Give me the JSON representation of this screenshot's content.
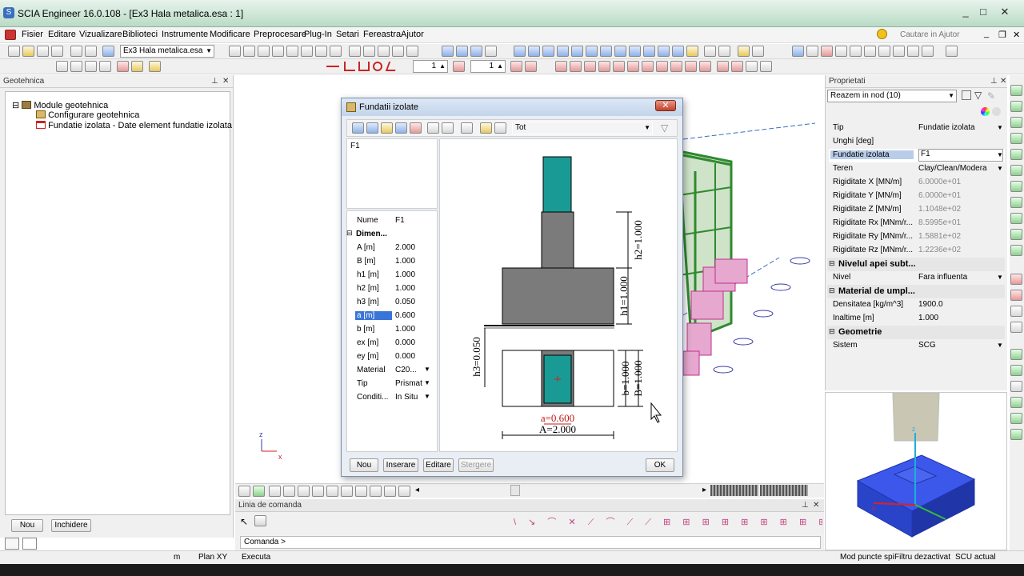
{
  "window": {
    "title": "SCIA Engineer 16.0.108 - [Ex3 Hala metalica.esa : 1]",
    "controls": {
      "minimize": "_",
      "maximize": "□",
      "close": "✕"
    },
    "inner_controls": {
      "minimize": "_",
      "restore": "❐",
      "close": "✕"
    }
  },
  "menu": {
    "items": [
      "Fisier",
      "Editare",
      "Vizualizare",
      "Biblioteci",
      "Instrumente",
      "Modificare",
      "Preprocesare",
      "Plug-In",
      "Setari",
      "Fereastra",
      "Ajutor"
    ],
    "search_placeholder": "Cautare in Ajutor"
  },
  "toolbar": {
    "project_combo": "Ex3 Hala metalica.esa",
    "spin1": "1",
    "spin2": "1"
  },
  "left_panel": {
    "header": "Geotehnica",
    "tree": [
      {
        "label": "Module geotehnica",
        "level": 0,
        "expander": "⊟"
      },
      {
        "label": "Configurare geotehnica",
        "level": 1
      },
      {
        "label": "Fundatie izolata - Date element fundatie izolata",
        "level": 1
      }
    ],
    "buttons": {
      "new": "Nou",
      "close": "Inchidere"
    }
  },
  "dialog": {
    "title": "Fundatii izolate",
    "filter": "Tot",
    "list_items": [
      "F1"
    ],
    "properties": [
      {
        "key": "Nume",
        "value": "F1"
      },
      {
        "key": "Dimen...",
        "value": "",
        "section": true
      },
      {
        "key": "A [m]",
        "value": "2.000"
      },
      {
        "key": "B [m]",
        "value": "1.000"
      },
      {
        "key": "h1 [m]",
        "value": "1.000"
      },
      {
        "key": "h2 [m]",
        "value": "1.000"
      },
      {
        "key": "h3 [m]",
        "value": "0.050"
      },
      {
        "key": "a [m]",
        "value": "0.600",
        "selected": true
      },
      {
        "key": "b [m]",
        "value": "1.000"
      },
      {
        "key": "ex [m]",
        "value": "0.000"
      },
      {
        "key": "ey [m]",
        "value": "0.000"
      },
      {
        "key": "Material",
        "value": "C20..."
      },
      {
        "key": "Tip",
        "value": "Prismat"
      },
      {
        "key": "Conditi...",
        "value": "In Situ"
      }
    ],
    "drawing_labels": {
      "h2": "h2=1.000",
      "h1": "h1=1.000",
      "h3": "h3=0.050",
      "b": "b=1.000",
      "B": "B=1.000",
      "a": "a=0.600",
      "A": "A=2.000"
    },
    "buttons": {
      "new": "Nou",
      "insert": "Inserare",
      "edit": "Editare",
      "delete": "Stergere",
      "ok": "OK"
    }
  },
  "right_panel": {
    "header": "Proprietati",
    "selector": "Reazem in nod (10)",
    "rows": [
      {
        "k": "Tip",
        "v": "Fundatie izolata",
        "dd": true
      },
      {
        "k": "Unghi [deg]",
        "v": ""
      },
      {
        "k": "Fundatie izolata",
        "v": "F1",
        "dd": true,
        "sel": true
      },
      {
        "k": "Teren",
        "v": "Clay/Clean/Modera",
        "dd": true
      },
      {
        "k": "Rigiditate X [MN/m]",
        "v": "6.0000e+01",
        "gray": true
      },
      {
        "k": "Rigiditate Y [MN/m]",
        "v": "6.0000e+01",
        "gray": true
      },
      {
        "k": "Rigiditate Z [MN/m]",
        "v": "1.1048e+02",
        "gray": true
      },
      {
        "k": "Rigiditate Rx [MNm/r...",
        "v": "8.5995e+01",
        "gray": true
      },
      {
        "k": "Rigiditate Ry [MNm/r...",
        "v": "1.5881e+02",
        "gray": true
      },
      {
        "k": "Rigiditate Rz [MNm/r...",
        "v": "1.2236e+02",
        "gray": true
      }
    ],
    "sec_water": "Nivelul apei subt...",
    "water_rows": [
      {
        "k": "Nivel",
        "v": "Fara influenta",
        "dd": true
      }
    ],
    "sec_fill": "Material de umpl...",
    "fill_rows": [
      {
        "k": "Densitatea [kg/m^3]",
        "v": "1900.0"
      },
      {
        "k": "Inaltime [m]",
        "v": "1.000"
      }
    ],
    "sec_geom": "Geometrie",
    "geom_rows": [
      {
        "k": "Sistem",
        "v": "SCG",
        "dd": true
      }
    ]
  },
  "command": {
    "header": "Linia de comanda",
    "prompt": "Comanda >"
  },
  "status": {
    "unit": "m",
    "plane": "Plan XY",
    "mode": "Executa",
    "snap": "Mod puncte spi",
    "filter": "Filtru dezactivat",
    "ucs": "SCU actual"
  },
  "axis": {
    "x": "x",
    "z": "z"
  },
  "colors": {
    "column_teal": "#1a9a95",
    "concrete_gray": "#7b7b7b",
    "selection_blue": "#3875d7",
    "dim_red": "#c01818",
    "preview_blue": "#2a44e0"
  }
}
